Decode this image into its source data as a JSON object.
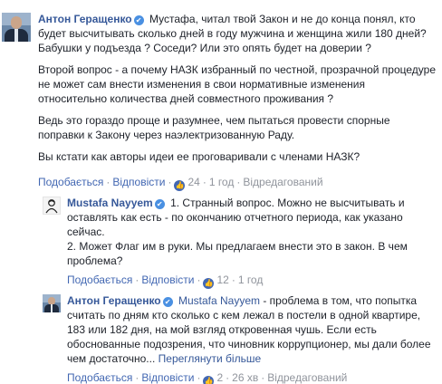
{
  "comments": [
    {
      "author": "Антон Геращенко",
      "verified_icon": "✔",
      "paragraphs": [
        "Мустафа, читал твой Закон и не до конца понял, кто будет высчитывать сколько дней в году мужчина и женщина жили 180 дней? Бабушки у подъезда ? Соседи? Или это опять будет на доверии ?",
        "Второй вопрос - а почему НАЗК избранный по честной, прозрачной процедуре не может сам внести изменения в свои нормативные изменения относительно количества дней совместного проживания ?",
        "Ведь это гораздо проще и разумнее, чем пытаться провести спорные поправки к Закону через наэлектризованную Раду.",
        "Вы кстати как авторы идеи ее проговаривали с членами НАЗК?"
      ],
      "actions": {
        "like": "Подобається",
        "reply": "Відповісти",
        "like_count": "24",
        "time": "1 год",
        "edited": "Відредагований"
      }
    },
    {
      "author": "Mustafa Nayyem",
      "verified_icon": "✔",
      "line1": "1. Странный вопрос. Можно не высчитывать и оставлять как есть - по окончанию отчетного периода, как указано сейчас.",
      "line2": "2. Может Флаг им в руки. Мы предлагаем внести это в закон. В чем проблема?",
      "actions": {
        "like": "Подобається",
        "reply": "Відповісти",
        "like_count": "12",
        "time": "1 год"
      }
    },
    {
      "author": "Антон Геращенко",
      "verified_icon": "✔",
      "mention": "Mustafa Nayyem",
      "text": " - проблема в том, что попытка считать по дням кто сколько с кем лежал в постели в одной квартире, 183 или 182 дня, на мой взгляд откровенная чушь. Если есть обоснованные подозрения, что чиновник коррупционер, мы дали более чем достаточно...",
      "see_more": "Переглянути більше",
      "actions": {
        "like": "Подобається",
        "reply": "Відповісти",
        "like_count": "2",
        "time": "26 хв",
        "edited": "Відредагований"
      }
    }
  ],
  "icons": {
    "like": "thumbs-up-icon",
    "verified": "verified-badge-icon"
  }
}
